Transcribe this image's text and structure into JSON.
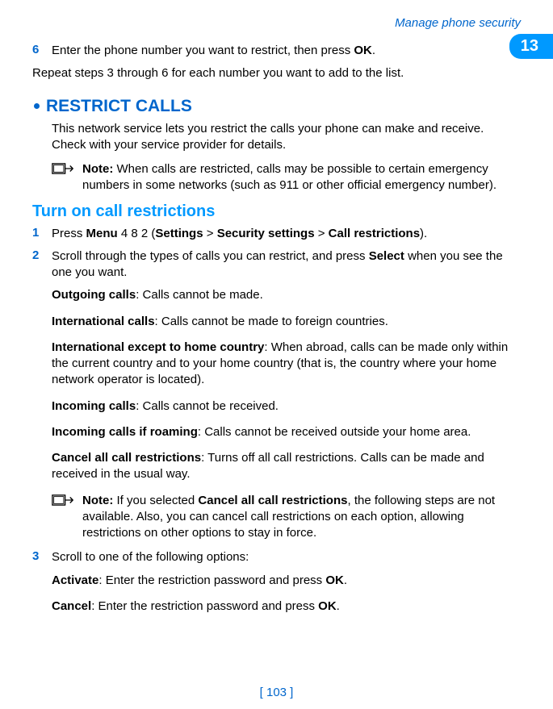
{
  "header": {
    "sectionName": "Manage phone security",
    "chapterNumber": "13"
  },
  "topStep": {
    "num": "6",
    "text_before": "Enter the phone number you want to restrict, then press ",
    "text_bold": "OK",
    "text_after": "."
  },
  "repeatLine": "Repeat steps 3 through 6 for each number you want to add to the list.",
  "restrict": {
    "heading": "RESTRICT CALLS",
    "intro": "This network service lets you restrict the calls your phone can make and receive. Check with your service provider for details.",
    "note1_bold": "Note:",
    "note1_text": " When calls are restricted, calls may be possible to certain emergency numbers in some networks (such as 911 or other official emergency number)."
  },
  "turnOn": {
    "heading": "Turn on call restrictions",
    "step1": {
      "num": "1",
      "t1": "Press ",
      "b1": "Menu",
      "t2": " 4 8 2 (",
      "b2": "Settings",
      "t3": " > ",
      "b3": "Security settings",
      "t4": " > ",
      "b4": "Call restrictions",
      "t5": ")."
    },
    "step2": {
      "num": "2",
      "t1": "Scroll through the types of calls you can restrict, and press ",
      "b1": "Select",
      "t2": " when you see the one you want."
    },
    "items": [
      {
        "label": "Outgoing calls",
        "desc": ": Calls cannot be made."
      },
      {
        "label": "International calls",
        "desc": ": Calls cannot be made to foreign countries."
      },
      {
        "label": "International except to home country",
        "desc": ": When abroad, calls can be made only within the current country and to your home country (that is, the country where your home network operator is located)."
      },
      {
        "label": "Incoming calls",
        "desc": ": Calls cannot be received."
      },
      {
        "label": "Incoming calls if roaming",
        "desc": ": Calls cannot be received outside your home area."
      },
      {
        "label": "Cancel all call restrictions",
        "desc": ": Turns off all call restrictions. Calls can be made and received in the usual way."
      }
    ],
    "note2_bold": "Note:",
    "note2_t1": " If you selected ",
    "note2_b1": "Cancel all call restrictions",
    "note2_t2": ", the following steps are not available. Also, you can cancel call restrictions on each option, allowing restrictions on other options to stay in force.",
    "step3": {
      "num": "3",
      "text": "Scroll to one of the following options:"
    },
    "opt1": {
      "label": "Activate",
      "t1": ": Enter the restriction password and press ",
      "b1": "OK",
      "t2": "."
    },
    "opt2": {
      "label": "Cancel",
      "t1": ": Enter the restriction password and press ",
      "b1": "OK",
      "t2": "."
    }
  },
  "footer": {
    "pageNum": "[ 103 ]"
  }
}
